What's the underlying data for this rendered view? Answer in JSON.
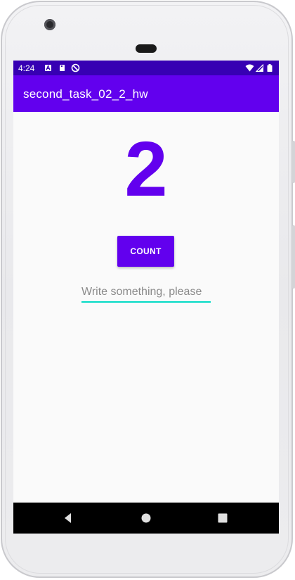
{
  "status_bar": {
    "time": "4:24",
    "background_color": "#3700b3",
    "left_icons": [
      "font-icon",
      "sd-card-icon",
      "no-sync-icon"
    ],
    "right_icons": [
      "wifi-icon",
      "signal-icon",
      "battery-icon"
    ]
  },
  "app_bar": {
    "title": "second_task_02_2_hw",
    "background_color": "#6200ee"
  },
  "main": {
    "counter_value": "2",
    "counter_color": "#6200ee",
    "count_button_label": "COUNT",
    "count_button_color": "#6200ee",
    "input": {
      "placeholder": "Write something, please",
      "value": "",
      "underline_color": "#03dac5"
    }
  },
  "nav_bar": {
    "buttons": [
      "back-icon",
      "home-icon",
      "recents-icon"
    ]
  }
}
